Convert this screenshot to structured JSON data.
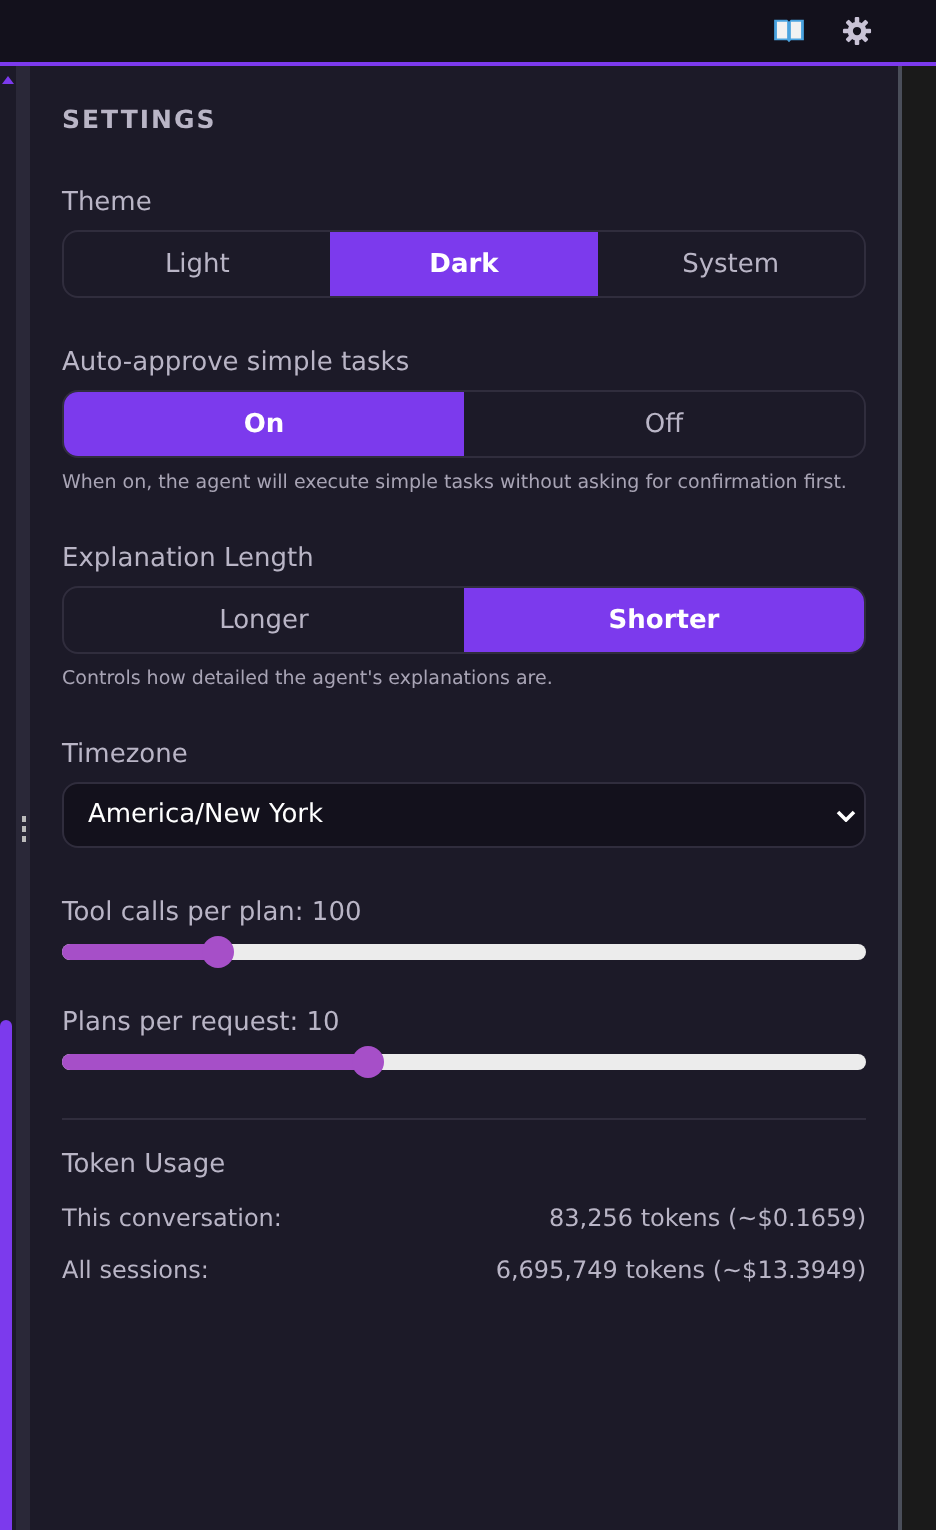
{
  "header": {
    "title": "SETTINGS"
  },
  "segments": [
    {
      "label": "Theme",
      "options": [
        {
          "label": "Light",
          "selected": false
        },
        {
          "label": "Dark",
          "selected": true
        },
        {
          "label": "System",
          "selected": false
        }
      ]
    },
    {
      "label": "Auto-approve simple tasks",
      "options": [
        {
          "label": "On",
          "selected": true
        },
        {
          "label": "Off",
          "selected": false
        }
      ],
      "help": "When on, the agent will execute simple tasks without asking for confirmation first."
    },
    {
      "label": "Explanation Length",
      "options": [
        {
          "label": "Longer",
          "selected": false
        },
        {
          "label": "Shorter",
          "selected": true
        }
      ],
      "help": "Controls how detailed the agent's explanations are."
    }
  ],
  "timezone": {
    "label": "Timezone",
    "value": "America/New York"
  },
  "sliders": [
    {
      "label": "Tool calls per plan: 100",
      "level": 0.195
    },
    {
      "label": "Plans per request: 10",
      "level": 0.38
    }
  ],
  "token_usage": {
    "title": "Token Usage",
    "rows": [
      {
        "label": "This conversation:",
        "value": "83,256 tokens (~$0.1659)"
      },
      {
        "label": "All sessions:",
        "value": "6,695,749 tokens (~$13.3949)"
      }
    ]
  }
}
